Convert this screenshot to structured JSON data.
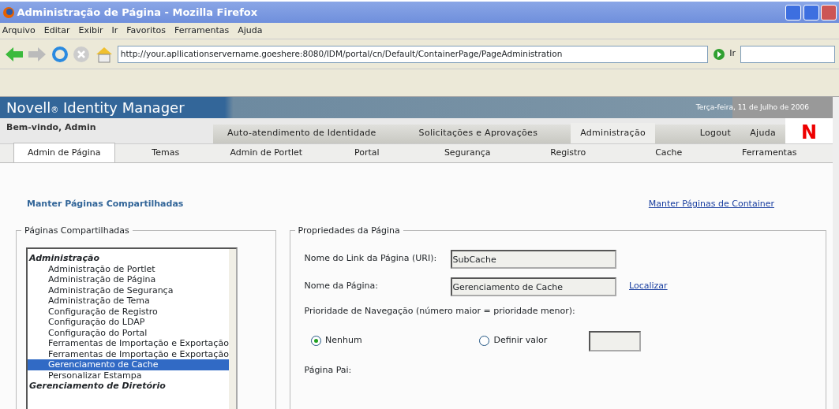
{
  "window": {
    "title": "Administração de Página - Mozilla Firefox"
  },
  "menu_bar": [
    "Arquivo",
    "Editar",
    "Exibir",
    "Ir",
    "Favoritos",
    "Ferramentas",
    "Ajuda"
  ],
  "toolbar": {
    "url": "http://your.apllicationservername.goeshere:8080/IDM/portal/cn/Default/ContainerPage/PageAdministration",
    "go_label": "Ir"
  },
  "header": {
    "brand": "Novell$_{®}$ Identity Manager",
    "date": "Terça-feira, 11 de Julho de 2006",
    "logo": "N",
    "welcome": "Bem-vindo, Admin"
  },
  "main_tabs": [
    {
      "label": "Auto-atendimento de Identidade",
      "selected": false
    },
    {
      "label": "Solicitações e Aprovações",
      "selected": false
    },
    {
      "label": "Administração",
      "selected": true
    }
  ],
  "utility_links": [
    "Logout",
    "Ajuda"
  ],
  "sub_tabs": [
    {
      "label": "Admin de Página",
      "selected": true
    },
    {
      "label": "Temas",
      "selected": false
    },
    {
      "label": "Admin de Portlet",
      "selected": false
    },
    {
      "label": "Portal",
      "selected": false
    },
    {
      "label": "Segurança",
      "selected": false
    },
    {
      "label": "Registro",
      "selected": false
    },
    {
      "label": "Cache",
      "selected": false
    },
    {
      "label": "Ferramentas",
      "selected": false
    }
  ],
  "links": {
    "shared": "Manter Páginas Compartilhadas",
    "container": "Manter Páginas de Container"
  },
  "shared_pages": {
    "legend": "Páginas Compartilhadas",
    "items": [
      {
        "kind": "group",
        "label": "Administração",
        "selected": false
      },
      {
        "kind": "item",
        "label": "Administração de Portlet",
        "selected": false
      },
      {
        "kind": "item",
        "label": "Administração de Página",
        "selected": false
      },
      {
        "kind": "item",
        "label": "Administração de Segurança",
        "selected": false
      },
      {
        "kind": "item",
        "label": "Administração de Tema",
        "selected": false
      },
      {
        "kind": "item",
        "label": "Configuração de Registro",
        "selected": false
      },
      {
        "kind": "item",
        "label": "Configuração do LDAP",
        "selected": false
      },
      {
        "kind": "item",
        "label": "Configuração do Portal",
        "selected": false
      },
      {
        "kind": "item",
        "label": "Ferramentas de Importação e Exportação",
        "selected": false
      },
      {
        "kind": "item",
        "label": "Ferramentas de Importação e Exportação",
        "selected": false
      },
      {
        "kind": "item",
        "label": "Gerenciamento de Cache",
        "selected": true
      },
      {
        "kind": "item",
        "label": "Personalizar Estampa",
        "selected": false
      },
      {
        "kind": "group",
        "label": "Gerenciamento de Diretório",
        "selected": false
      }
    ]
  },
  "page_properties": {
    "legend": "Propriedades da Página",
    "link_name": {
      "label": "Nome do Link da Página (URI):",
      "value": "SubCache"
    },
    "page_name": {
      "label": "Nome da Página:",
      "value": "Gerenciamento de Cache",
      "link": "Localizar"
    },
    "priority_label": "Prioridade de Navegação (número maior = prioridade menor):",
    "priority_options": [
      {
        "label": "Nenhum",
        "selected": true
      },
      {
        "label": "Definir valor",
        "selected": false
      }
    ],
    "parent_label": "Página Pai:"
  }
}
